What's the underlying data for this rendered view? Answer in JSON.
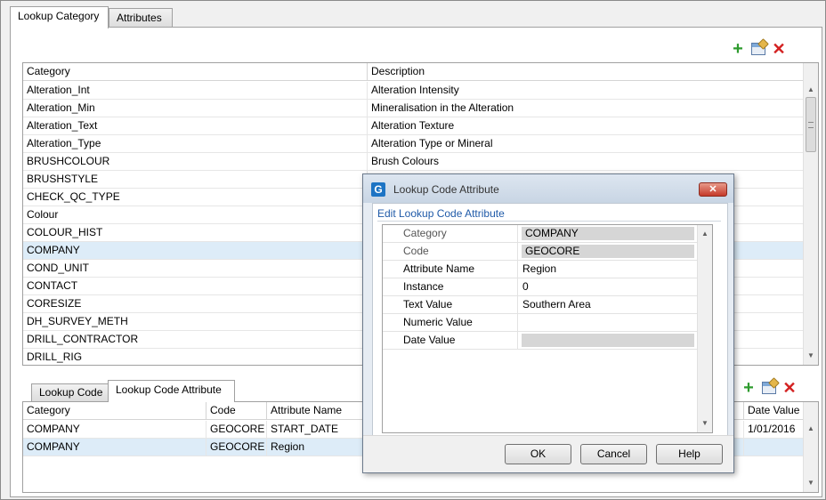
{
  "top_tabs": [
    {
      "label": "Lookup Category",
      "active": true
    },
    {
      "label": "Attributes",
      "active": false
    }
  ],
  "category_grid": {
    "headers": [
      "Category",
      "Description"
    ],
    "rows": [
      [
        "Alteration_Int",
        "Alteration Intensity"
      ],
      [
        "Alteration_Min",
        "Mineralisation in the Alteration"
      ],
      [
        "Alteration_Text",
        "Alteration Texture"
      ],
      [
        "Alteration_Type",
        "Alteration Type or Mineral"
      ],
      [
        "BRUSHCOLOUR",
        "Brush Colours"
      ],
      [
        "BRUSHSTYLE",
        ""
      ],
      [
        "CHECK_QC_TYPE",
        ""
      ],
      [
        "Colour",
        ""
      ],
      [
        "COLOUR_HIST",
        ""
      ],
      [
        "COMPANY",
        ""
      ],
      [
        "COND_UNIT",
        ""
      ],
      [
        "CONTACT",
        ""
      ],
      [
        "CORESIZE",
        ""
      ],
      [
        "DH_SURVEY_METH",
        ""
      ],
      [
        "DRILL_CONTRACTOR",
        ""
      ],
      [
        "DRILL_RIG",
        ""
      ]
    ],
    "selected_row": 9
  },
  "bottom_tabs": [
    {
      "label": "Lookup Code",
      "active": false
    },
    {
      "label": "Lookup Code Attribute",
      "active": true
    }
  ],
  "attribute_grid": {
    "headers": [
      "Category",
      "Code",
      "Attribute Name",
      "Date Value"
    ],
    "rows": [
      [
        "COMPANY",
        "GEOCORE",
        "START_DATE",
        "1/01/2016"
      ],
      [
        "COMPANY",
        "GEOCORE",
        "Region",
        ""
      ]
    ],
    "selected_row": 1
  },
  "toolbar_icons": [
    "add-icon",
    "properties-icon",
    "delete-icon"
  ],
  "dialog": {
    "app_icon": "G",
    "title": "Lookup Code Attribute",
    "heading": "Edit Lookup Code Attribute",
    "fields": [
      {
        "label": "Category",
        "value": "COMPANY",
        "readonly": true
      },
      {
        "label": "Code",
        "value": "GEOCORE",
        "readonly": true
      },
      {
        "label": "Attribute Name",
        "value": "Region",
        "readonly": false
      },
      {
        "label": "Instance",
        "value": "0",
        "readonly": false
      },
      {
        "label": "Text Value",
        "value": "Southern Area",
        "readonly": false
      },
      {
        "label": "Numeric Value",
        "value": "",
        "readonly": false
      },
      {
        "label": "Date Value",
        "value": "",
        "readonly": false
      }
    ],
    "buttons": {
      "ok": "OK",
      "cancel": "Cancel",
      "help": "Help"
    }
  },
  "colors": {
    "selection": "#ddecf8",
    "heading_blue": "#1f5aa8",
    "add_green": "#2e9b2e",
    "delete_red": "#d32020"
  }
}
